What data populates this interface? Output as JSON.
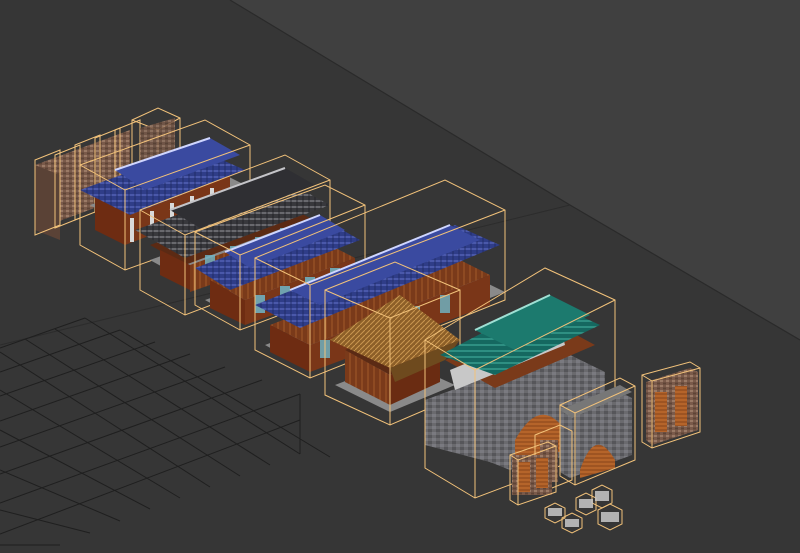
{
  "app": {
    "view": "perspective-viewport",
    "background_color": "#3c3c3c",
    "grid_color": "#1e1e1e",
    "selection_color": "#f2c27a"
  },
  "scene": {
    "objects": [
      {
        "name": "stone-wall-segments",
        "kind": "stone-wall",
        "selected": true
      },
      {
        "name": "hall-blue-roof-1",
        "kind": "hall",
        "roof_color": "#33428e",
        "selected": true
      },
      {
        "name": "hall-gray-roof",
        "kind": "hall",
        "roof_color": "#3b3b3f",
        "selected": true
      },
      {
        "name": "hall-blue-roof-2",
        "kind": "hall",
        "roof_color": "#33428e",
        "selected": true
      },
      {
        "name": "hall-blue-roof-3",
        "kind": "hall",
        "roof_color": "#33428e",
        "selected": true
      },
      {
        "name": "pavilion-thatch-roof",
        "kind": "pavilion",
        "roof_color": "#9a6a2e",
        "selected": true
      },
      {
        "name": "fortress-gate-green-roof",
        "kind": "gate",
        "roof_color": "#1c7068",
        "selected": true
      },
      {
        "name": "small-gate-round-door",
        "kind": "gate",
        "selected": true
      },
      {
        "name": "small-gate-side",
        "kind": "gate",
        "selected": true
      },
      {
        "name": "wooden-doors",
        "kind": "door",
        "selected": true
      },
      {
        "name": "small-props",
        "kind": "prop",
        "selected": true
      }
    ]
  }
}
